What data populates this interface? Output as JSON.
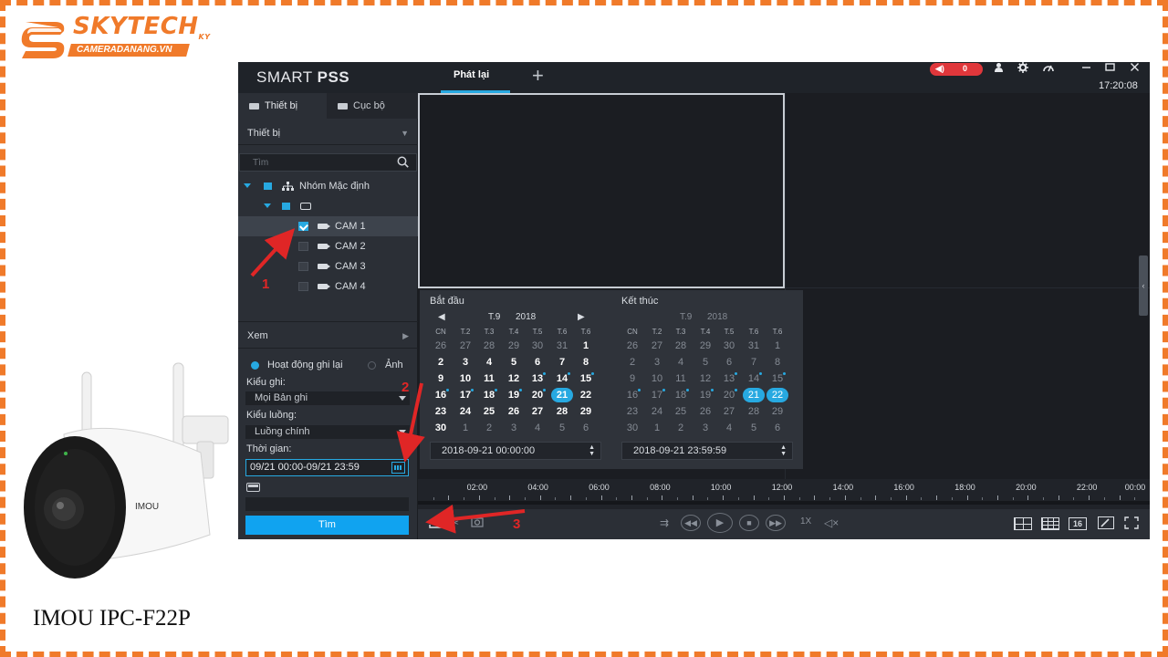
{
  "logo": {
    "brand": "SKYTECH",
    "suffix": "KY",
    "site": "CAMERADANANG.VN",
    "color": "#f07a2a"
  },
  "product": {
    "caption": "IMOU IPC-F22P",
    "camera_brand": "IMOU"
  },
  "app": {
    "title_light": "SMART ",
    "title_bold": "PSS",
    "active_tab": "Phát lại",
    "add_tab": "+",
    "alarm_count": "0",
    "clock": "17:20:08",
    "accent": "#27a9e1",
    "window_icons": [
      "user-icon",
      "gear-icon",
      "performance-icon",
      "minimize-icon",
      "maximize-icon",
      "close-icon"
    ]
  },
  "sidebar": {
    "tabs": [
      {
        "label": "Thiết bị",
        "active": true
      },
      {
        "label": "Cục bộ",
        "active": false
      }
    ],
    "device_header": "Thiết bị",
    "search_placeholder": "Tìm",
    "tree": {
      "group": "Nhóm Mặc định",
      "cameras": [
        {
          "label": "CAM 1",
          "checked": true
        },
        {
          "label": "CAM 2",
          "checked": false
        },
        {
          "label": "CAM 3",
          "checked": false
        },
        {
          "label": "CAM 4",
          "checked": false
        }
      ]
    },
    "view_header": "Xem",
    "record_option": "Hoạt động ghi lại",
    "image_option": "Ảnh",
    "record_type_label": "Kiểu ghi:",
    "record_type_value": "Mọi Bản ghi",
    "stream_label": "Kiểu luồng:",
    "stream_value": "Luồng chính",
    "time_label": "Thời gian:",
    "time_value": "09/21 00:00-09/21 23:59",
    "search_button": "Tìm"
  },
  "calendar_start": {
    "title": "Bắt đầu",
    "month": "T.9",
    "year": "2018",
    "days_of_week": [
      "CN",
      "T.2",
      "T.3",
      "T.4",
      "T.5",
      "T.6",
      "T.6"
    ],
    "weeks": [
      [
        "26",
        "27",
        "28",
        "29",
        "30",
        "31",
        "1"
      ],
      [
        "2",
        "3",
        "4",
        "5",
        "6",
        "7",
        "8"
      ],
      [
        "9",
        "10",
        "11",
        "12",
        "13",
        "14",
        "15"
      ],
      [
        "16",
        "17",
        "18",
        "19",
        "20",
        "21",
        "22"
      ],
      [
        "23",
        "24",
        "25",
        "26",
        "27",
        "28",
        "29"
      ],
      [
        "30",
        "1",
        "2",
        "3",
        "4",
        "5",
        "6"
      ]
    ],
    "selected": [
      "21"
    ],
    "datetime": "2018-09-21 00:00:00"
  },
  "calendar_end": {
    "title": "Kết thúc",
    "month": "T.9",
    "year": "2018",
    "days_of_week": [
      "CN",
      "T.2",
      "T.3",
      "T.4",
      "T.5",
      "T.6",
      "T.6"
    ],
    "weeks": [
      [
        "26",
        "27",
        "28",
        "29",
        "30",
        "31",
        "1"
      ],
      [
        "2",
        "3",
        "4",
        "5",
        "6",
        "7",
        "8"
      ],
      [
        "9",
        "10",
        "11",
        "12",
        "13",
        "14",
        "15"
      ],
      [
        "16",
        "17",
        "18",
        "19",
        "20",
        "21",
        "22"
      ],
      [
        "23",
        "24",
        "25",
        "26",
        "27",
        "28",
        "29"
      ],
      [
        "30",
        "1",
        "2",
        "3",
        "4",
        "5",
        "6"
      ]
    ],
    "selected": [
      "21",
      "22"
    ],
    "datetime": "2018-09-21 23:59:59"
  },
  "timeline": {
    "labels": [
      "02:00",
      "04:00",
      "06:00",
      "08:00",
      "10:00",
      "12:00",
      "14:00",
      "16:00",
      "18:00",
      "20:00",
      "22:00",
      "00:00"
    ]
  },
  "toolbar": {
    "speed": "1X",
    "layout_16": "16"
  },
  "annotations": {
    "step1": "1",
    "step2": "2",
    "step3": "3",
    "color": "#e02626"
  }
}
